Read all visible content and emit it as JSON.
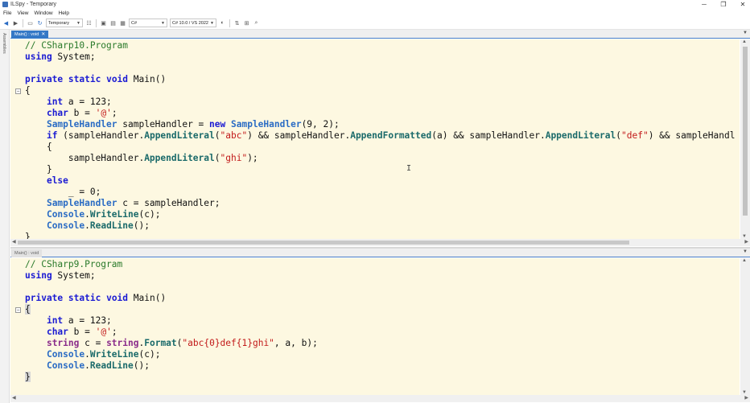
{
  "window": {
    "title": "ILSpy - Temporary",
    "minimize": "─",
    "maximize": "❐",
    "close": "✕"
  },
  "menu": [
    "File",
    "View",
    "Window",
    "Help"
  ],
  "toolbar": {
    "assembly_list": "Temporary",
    "language": "C#",
    "language_version": "C# 10.0 / VS 2022"
  },
  "sidebar": {
    "label": "Assemblies"
  },
  "panes": {
    "top": {
      "tab_label": "Main() : void",
      "close": "✕"
    },
    "bottom": {
      "tab_label": "Main() : void"
    }
  },
  "code_top": {
    "comment": "// CSharp10.Program",
    "using_kw": "using",
    "using_rest": " System;",
    "private_kw": "private",
    "static_kw": "static",
    "void_kw": "void",
    "main_sig": " Main()",
    "open_brace": "{",
    "int_kw": "int",
    "int_rest": " a = 123;",
    "char_kw": "char",
    "char_mid": " b = ",
    "char_lit": "'@'",
    "char_end": ";",
    "handler_type": "SampleHandler",
    "handler_decl": " sampleHandler = ",
    "new_kw": "new",
    "handler_ctor": "SampleHandler",
    "handler_args": "(9, 2);",
    "if_kw": "if",
    "if_1": " (sampleHandler.",
    "append_literal": "AppendLiteral",
    "lit_abc": "\"abc\"",
    "if_2": ") && sampleHandler.",
    "append_formatted": "AppendFormatted",
    "if_3": "(a) && sampleHandler.",
    "append_literal_2": "AppendLiteral",
    "lit_def": "\"def\"",
    "if_4": ") && sampleHandl",
    "inner_open": "{",
    "ghi_prefix": "sampleHandler.",
    "append_literal_3": "AppendLiteral",
    "lit_ghi": "\"ghi\"",
    "ghi_end": ");",
    "inner_close": "}",
    "else_kw": "else",
    "discard": "_ = 0;",
    "c_type": "SampleHandler",
    "c_rest": " c = sampleHandler;",
    "console_1": "Console",
    "writeline": "WriteLine",
    "writeline_args": "(c);",
    "console_2": "Console",
    "readline": "ReadLine",
    "readline_args": "();",
    "close_brace": "}"
  },
  "code_bottom": {
    "comment": "// CSharp9.Program",
    "using_kw": "using",
    "using_rest": " System;",
    "private_kw": "private",
    "static_kw": "static",
    "void_kw": "void",
    "main_sig": " Main()",
    "open_brace": "{",
    "int_kw": "int",
    "int_rest": " a = 123;",
    "char_kw": "char",
    "char_mid": " b = ",
    "char_lit": "'@'",
    "char_end": ";",
    "string_kw": "string",
    "string_mid": " c = ",
    "string_kw2": "string",
    "string_dot": ".",
    "format": "Format",
    "fmt_open": "(",
    "lit_fmt": "\"abc{0}def{1}ghi\"",
    "fmt_args": ", a, b);",
    "console_1": "Console",
    "writeline": "WriteLine",
    "writeline_args": "(c);",
    "console_2": "Console",
    "readline": "ReadLine",
    "readline_args": "();",
    "close_brace": "}"
  },
  "colors": {
    "editor_bg": "#fdf8e1",
    "keyword": "#1b1bd3",
    "type": "#8a2c8a",
    "string": "#c21a1a",
    "comment": "#2a7a2a",
    "tab_active": "#3478c6"
  }
}
